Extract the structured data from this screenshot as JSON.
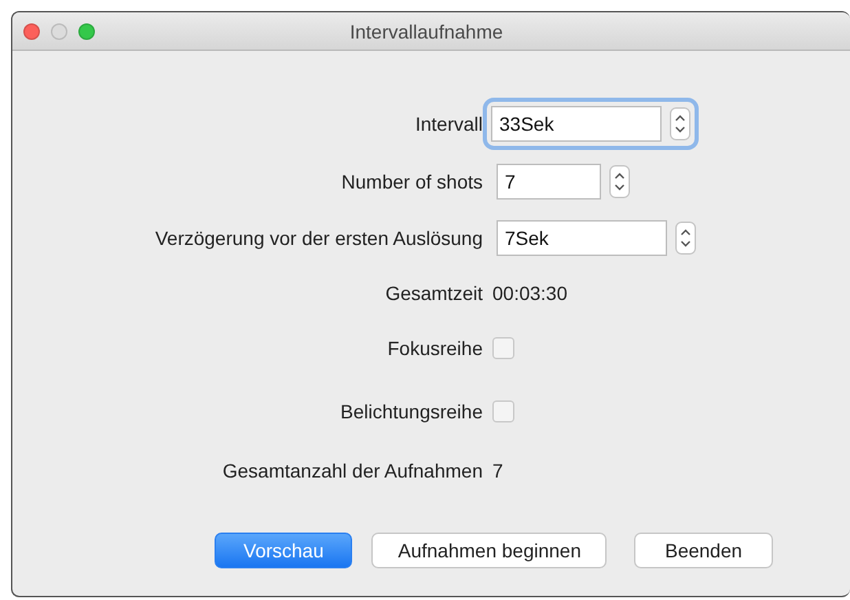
{
  "window": {
    "title": "Intervallaufnahme"
  },
  "rows": [
    {
      "kind": "stepper",
      "label": "Intervall",
      "value": "33Sek",
      "focused": true,
      "wide": true
    },
    {
      "kind": "stepper",
      "label": "Number of shots",
      "value": "7",
      "focused": false,
      "wide": false
    },
    {
      "kind": "stepper",
      "label": "Verzögerung vor der ersten Auslösung",
      "value": "7Sek",
      "focused": false,
      "wide": true
    },
    {
      "kind": "text",
      "label": "Gesamtzeit",
      "value": "00:03:30"
    },
    {
      "kind": "checkbox",
      "label": "Fokusreihe",
      "checked": false
    },
    {
      "kind": "checkbox",
      "label": "Belichtungsreihe",
      "checked": false
    },
    {
      "kind": "text",
      "label": "Gesamtanzahl der Aufnahmen",
      "value": "7"
    }
  ],
  "buttons": [
    {
      "label": "Vorschau",
      "default": true
    },
    {
      "label": "Aufnahmen beginnen",
      "default": false
    },
    {
      "label": "Beenden",
      "default": false
    }
  ]
}
